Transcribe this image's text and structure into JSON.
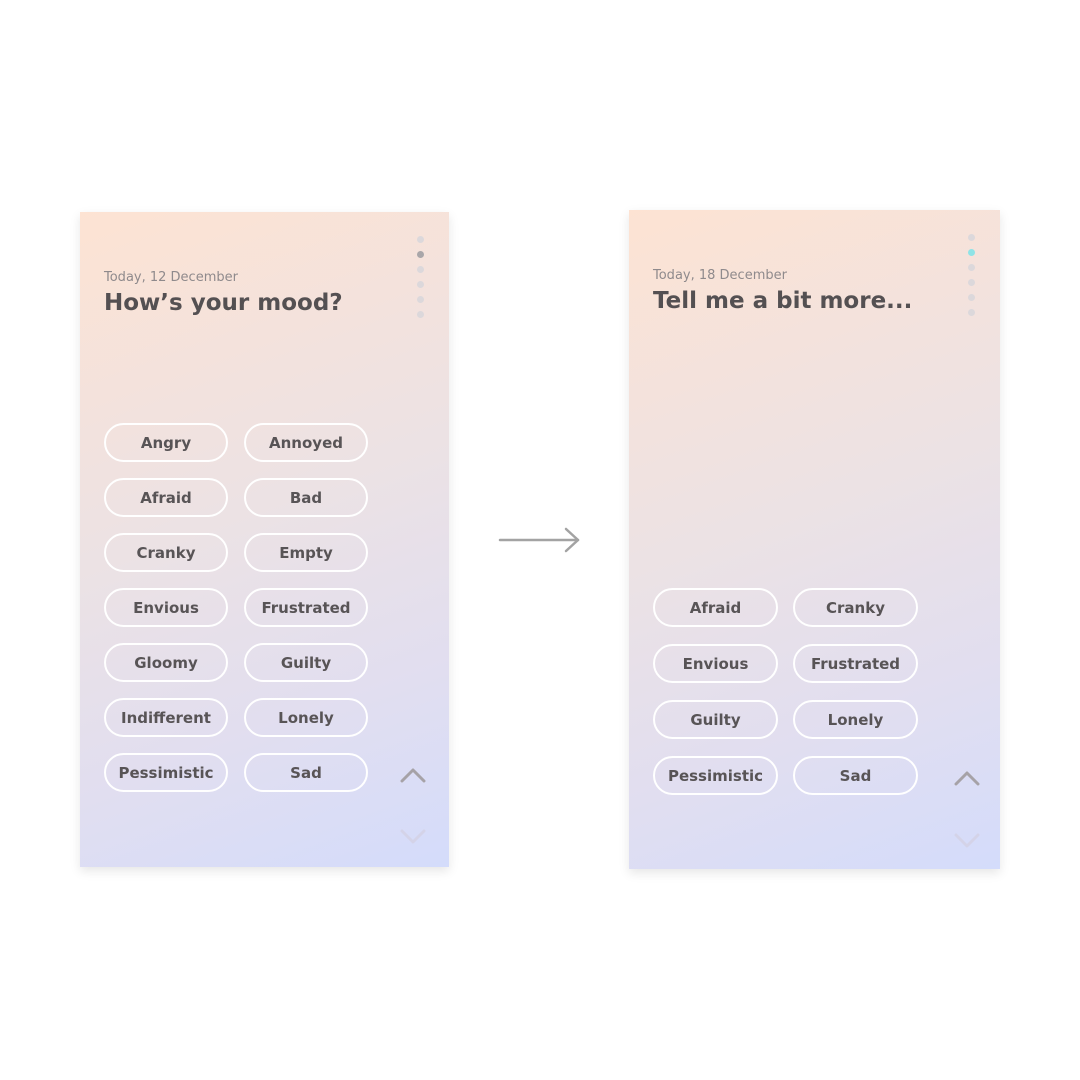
{
  "screens": [
    {
      "date": "Today, 12 December",
      "title": "How’s your mood?",
      "step_count": 6,
      "active_step": 2,
      "active_dot_color": "#a9a6a9",
      "moods": [
        "Angry",
        "Annoyed",
        "Afraid",
        "Bad",
        "Cranky",
        "Empty",
        "Envious",
        "Frustrated",
        "Gloomy",
        "Guilty",
        "Indifferent",
        "Lonely",
        "Pessimistic",
        "Sad"
      ]
    },
    {
      "date": "Today, 18 December",
      "title": "Tell me a bit more...",
      "step_count": 6,
      "active_step": 2,
      "active_dot_color": "#8fe3e6",
      "moods": [
        "Afraid",
        "Cranky",
        "Envious",
        "Frustrated",
        "Guilty",
        "Lonely",
        "Pessimistic",
        "Sad"
      ]
    }
  ],
  "icons": {
    "scroll_up": "chevron-up-icon",
    "scroll_down": "chevron-down-icon",
    "transition": "arrow-right-icon"
  },
  "colors": {
    "gradient_top": "#fde3d3",
    "gradient_bottom": "#d4dcfb",
    "text_dark": "#545052",
    "text_muted": "#8f8a8c",
    "chip_border": "#ffffff"
  }
}
